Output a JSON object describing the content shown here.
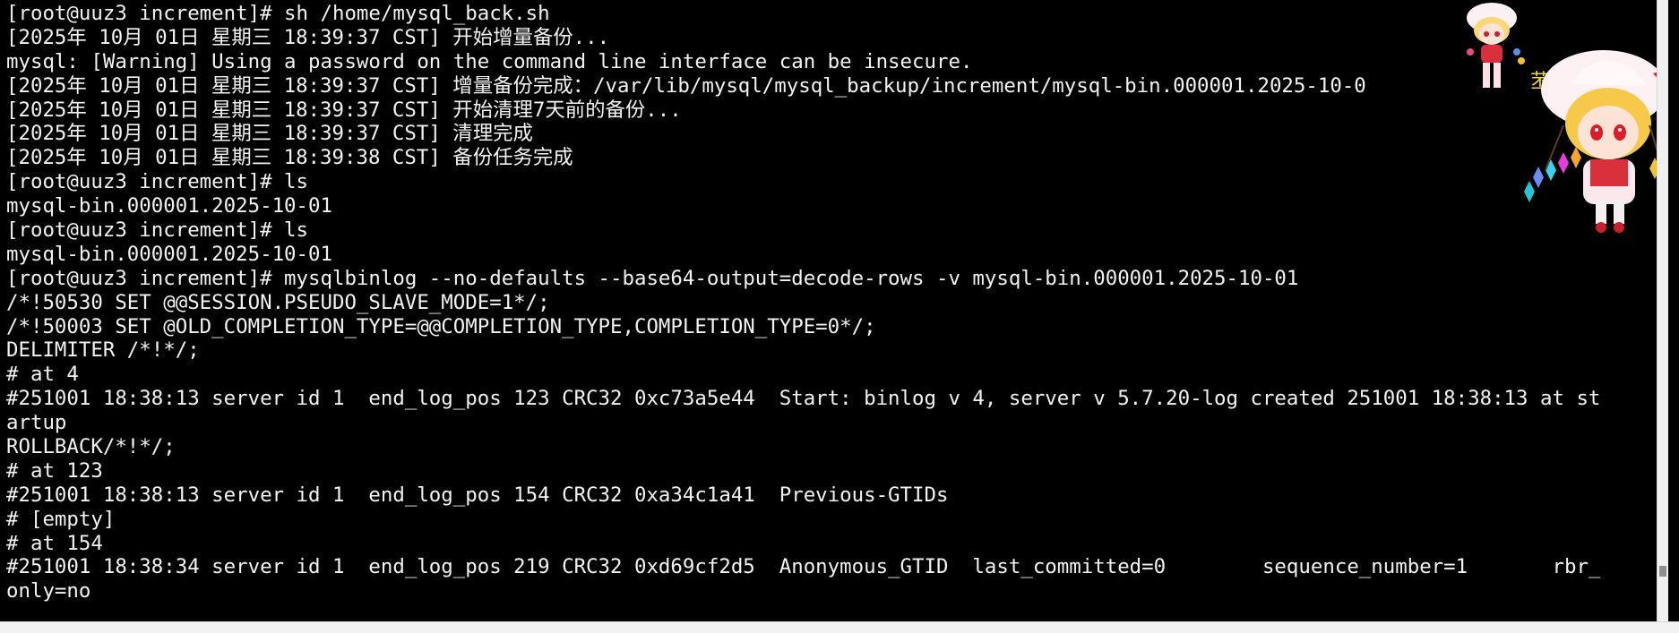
{
  "terminal": {
    "lines": [
      "[root@uuz3 increment]# sh /home/mysql_back.sh",
      "[2025年 10月 01日 星期三 18:39:37 CST] 开始增量备份...",
      "mysql: [Warning] Using a password on the command line interface can be insecure.",
      "[2025年 10月 01日 星期三 18:39:37 CST] 增量备份完成：/var/lib/mysql/mysql_backup/increment/mysql-bin.000001.2025-10-0",
      "[2025年 10月 01日 星期三 18:39:37 CST] 开始清理7天前的备份...",
      "[2025年 10月 01日 星期三 18:39:37 CST] 清理完成",
      "[2025年 10月 01日 星期三 18:39:38 CST] 备份任务完成",
      "[root@uuz3 increment]# ls",
      "mysql-bin.000001.2025-10-01",
      "[root@uuz3 increment]# ls",
      "mysql-bin.000001.2025-10-01",
      "[root@uuz3 increment]# mysqlbinlog --no-defaults --base64-output=decode-rows -v mysql-bin.000001.2025-10-01",
      "/*!50530 SET @@SESSION.PSEUDO_SLAVE_MODE=1*/;",
      "/*!50003 SET @OLD_COMPLETION_TYPE=@@COMPLETION_TYPE,COMPLETION_TYPE=0*/;",
      "DELIMITER /*!*/;",
      "# at 4",
      "#251001 18:38:13 server id 1  end_log_pos 123 CRC32 0xc73a5e44  Start: binlog v 4, server v 5.7.20-log created 251001 18:38:13 at st",
      "artup",
      "ROLLBACK/*!*/;",
      "# at 123",
      "#251001 18:38:13 server id 1  end_log_pos 154 CRC32 0xa34c1a41  Previous-GTIDs",
      "# [empty]",
      "# at 154",
      "#251001 18:38:34 server id 1  end_log_pos 219 CRC32 0xd69cf2d5  Anonymous_GTID  last_committed=0        sequence_number=1       rbr_",
      "only=no"
    ],
    "overlay_glyph": "苤"
  },
  "colors": {
    "background": "#000000",
    "foreground": "#f2f2f2"
  },
  "icons": {
    "mascot": "anime-chibi-character-sticker"
  }
}
